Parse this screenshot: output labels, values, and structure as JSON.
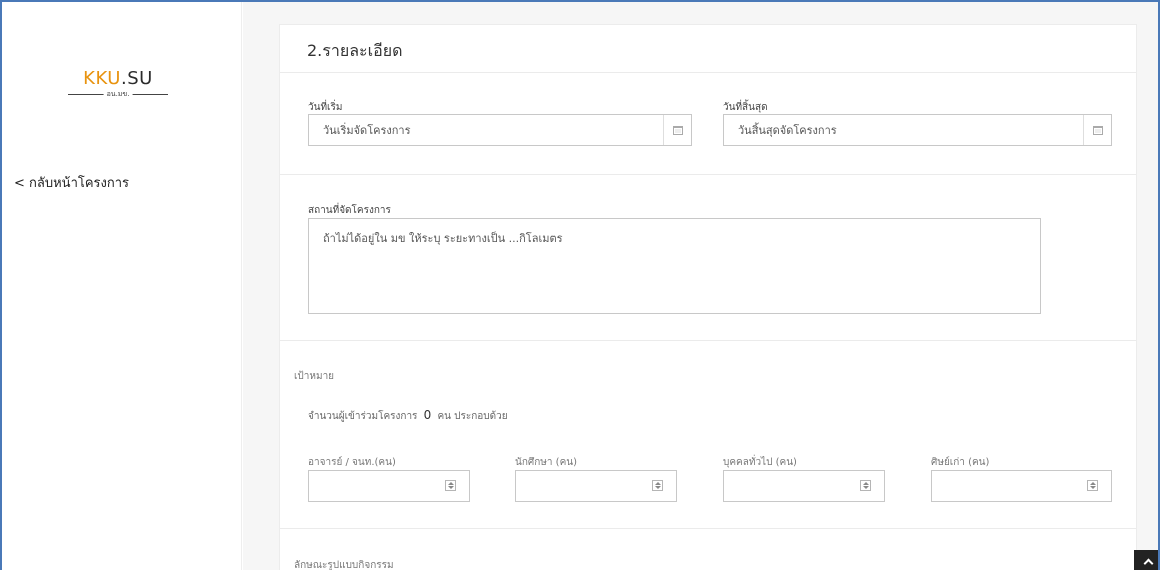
{
  "sidebar": {
    "logo": {
      "brand_main": "KKU",
      "brand_dot": ".",
      "brand_suffix": "SU",
      "subtitle": "อน.มข."
    },
    "back_link": "< กลับหน้าโครงการ"
  },
  "top_fragment": "ู",
  "section": {
    "title": "2.รายละเอียด",
    "start_date": {
      "label": "วันที่เริ่ม",
      "placeholder": "วันเริ่มจัดโครงการ"
    },
    "end_date": {
      "label": "วันที่สิ้นสุด",
      "placeholder": "วันสิ้นสุดจัดโครงการ"
    },
    "venue": {
      "label": "สถานที่จัดโครงการ",
      "placeholder": "ถ้าไม่ได้อยู่ใน มข ให้ระบุ ระยะทางเป็น ...กิโลเมตร"
    },
    "target": {
      "label": "เป้าหมาย",
      "count_prefix": "จำนวนผู้เข้าร่วมโครงการ",
      "count_value": "0",
      "count_suffix": "คน ประกอบด้วย",
      "fields": [
        {
          "label": "อาจารย์ / จนท.(คน)",
          "value": ""
        },
        {
          "label": "นักศึกษา (คน)",
          "value": ""
        },
        {
          "label": "บุคคลทั่วไป (คน)",
          "value": ""
        },
        {
          "label": "ศิษย์เก่า (คน)",
          "value": ""
        }
      ]
    },
    "activity_format": {
      "label": "ลักษณะรูปแบบกิจกรรม"
    }
  },
  "colors": {
    "accent_border": "#4a79b8",
    "logo_orange": "#e8930f"
  }
}
